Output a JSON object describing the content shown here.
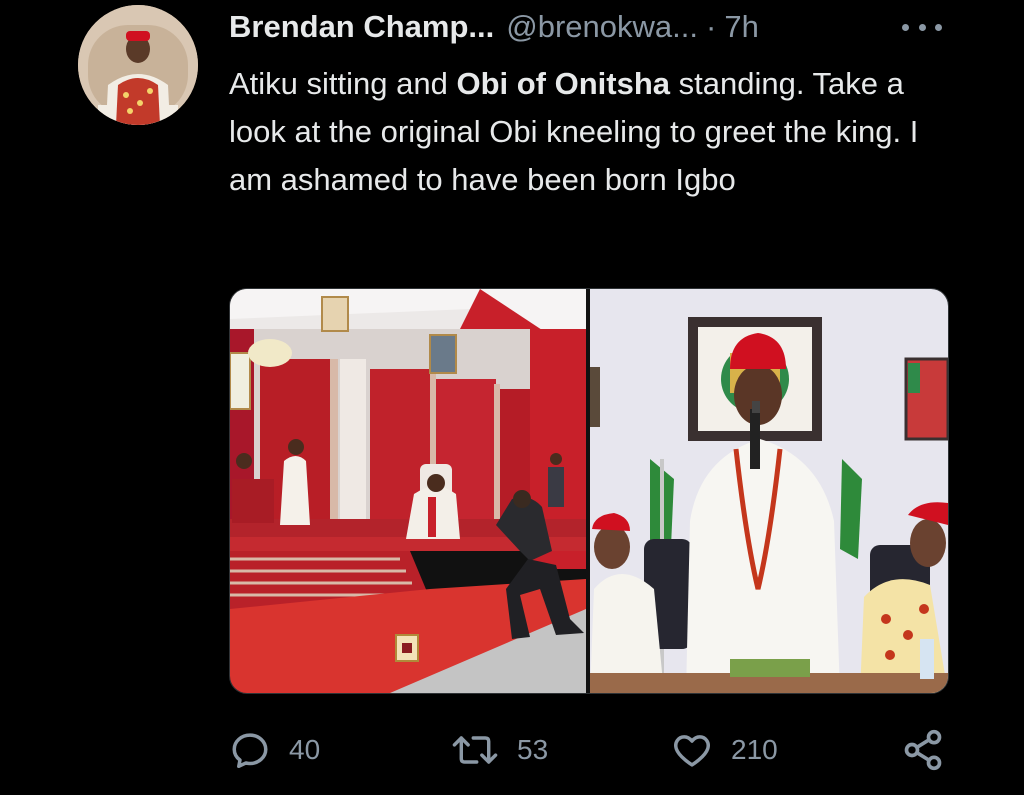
{
  "tweet": {
    "author_name": "Brendan Champ...",
    "author_handle": "@brenokwa...",
    "separator": "·",
    "time": "7h",
    "text_part1": "Atiku sitting and ",
    "text_bold": "Obi of Onitsha",
    "text_part2": " standing. Take a look at the original Obi kneeling to greet the king. I am ashamed to have been born Igbo"
  },
  "media": {
    "left_photo_icon": "throne-room-photo",
    "right_photo_icon": "speaker-photo"
  },
  "actions": {
    "reply_count": "40",
    "retweet_count": "53",
    "like_count": "210"
  },
  "colors": {
    "background": "#000000",
    "text_primary": "#e7e9ea",
    "text_secondary": "#8b98a5",
    "carpet_red": "#c8302f",
    "cap_red": "#d01020"
  }
}
